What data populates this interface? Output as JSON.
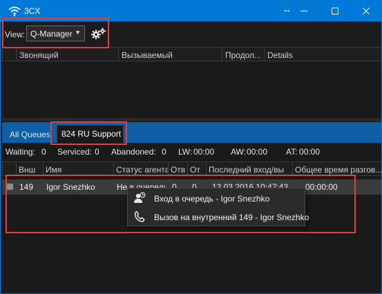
{
  "window": {
    "title": "3CX",
    "controls": {
      "resize_glyph": "↔",
      "minimize_glyph": "—",
      "maximize_glyph": "☐",
      "close_glyph": "✕"
    }
  },
  "toolbar": {
    "view_label": "View:",
    "view_value": "Q-Manager",
    "view_caret": "▼",
    "settings_icon": "gears-icon"
  },
  "calls_table": {
    "columns": [
      "Звонящий",
      "Вызываемый",
      "Продол...",
      "Details"
    ]
  },
  "queue_tabs": [
    "All Queues",
    "824 RU Support"
  ],
  "stats": {
    "waiting_label": "Waiting:",
    "waiting_value": "0",
    "serviced_label": "Serviced:",
    "serviced_value": "0",
    "abandoned_label": "Abandoned:",
    "abandoned_value": "0",
    "lw_label": "LW:",
    "lw_value": "00:00",
    "aw_label": "AW:",
    "aw_value": "00:00",
    "at_label": "AT:",
    "at_value": "00:00"
  },
  "agents_table": {
    "columns": [
      "Внш",
      "Имя",
      "Статус агента",
      "Отв",
      "От",
      "Последний вход/вы",
      "Общее время разгов..."
    ],
    "rows": [
      {
        "ext": "149",
        "name": "Igor Snezhko",
        "status": "Не в очереди",
        "answered": "0",
        "rejected": "0",
        "last_login": "12.03.2016 10:47:43",
        "total_talk_time": "00:00:00"
      }
    ]
  },
  "context_menu": {
    "items": [
      {
        "label": "Вход в очередь - Igor Snezhko",
        "icon": "queue-login-icon"
      },
      {
        "label": "Вызов на внутренний 149 - Igor Snezhko",
        "icon": "phone-icon"
      }
    ]
  },
  "colors": {
    "titlebar": "#0078d7",
    "tabbar": "#0e5fa8",
    "highlight": "#e04040",
    "background": "#1a1a1a"
  }
}
